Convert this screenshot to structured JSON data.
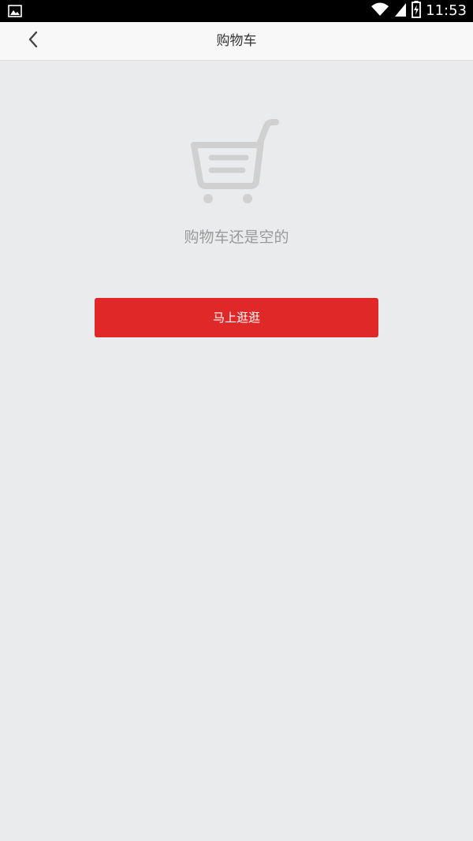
{
  "status_bar": {
    "time": "11:53",
    "icons": [
      "image-icon",
      "wifi-icon",
      "signal-icon",
      "battery-charging-icon"
    ]
  },
  "header": {
    "title": "购物车",
    "back_icon": "chevron-left-icon"
  },
  "empty_state": {
    "icon": "shopping-cart-icon",
    "message": "购物车还是空的",
    "button_label": "马上逛逛"
  },
  "colors": {
    "background": "#eaebec",
    "header_background": "#f8f8f8",
    "accent": "#e12828",
    "empty_text": "#9a9a9a",
    "cart_icon": "#d0d0d0"
  }
}
